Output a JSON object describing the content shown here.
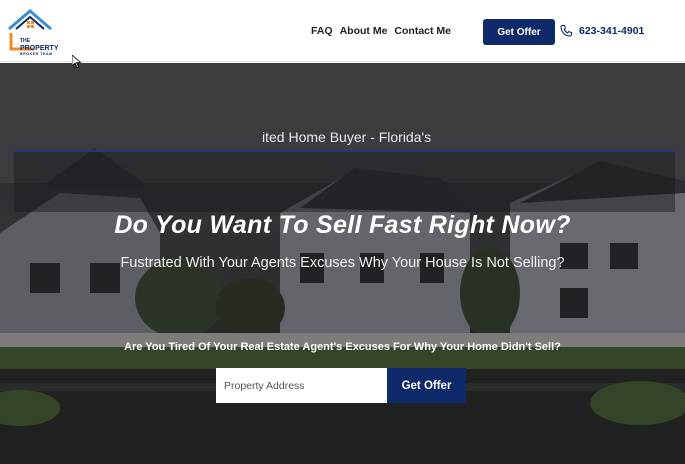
{
  "brand": {
    "logo_line1": "THE",
    "logo_line2": "PROPERTY",
    "logo_line3": "BROKER TEAM",
    "accent_orange": "#f08a24",
    "accent_navy": "#0e2a6b",
    "accent_blue": "#3a8fd6"
  },
  "nav": {
    "items": [
      "FAQ",
      "About Me",
      "Contact Me"
    ]
  },
  "header": {
    "cta_label": "Get Offer",
    "phone_icon": "phone-icon",
    "phone_number": "623-341-4901"
  },
  "hero": {
    "ticker_text": "ited Home Buyer - Florida's",
    "headline": "Do You Want To Sell Fast Right Now?",
    "subheadline": "Fustrated With Your Agents Excuses Why Your House Is Not Selling?",
    "question": "Are You Tired Of Your Real Estate Agent's Excuses For Why Your Home Didn't Sell?",
    "address_placeholder": "Property Address",
    "address_value": "",
    "submit_label": "Get Offer"
  }
}
